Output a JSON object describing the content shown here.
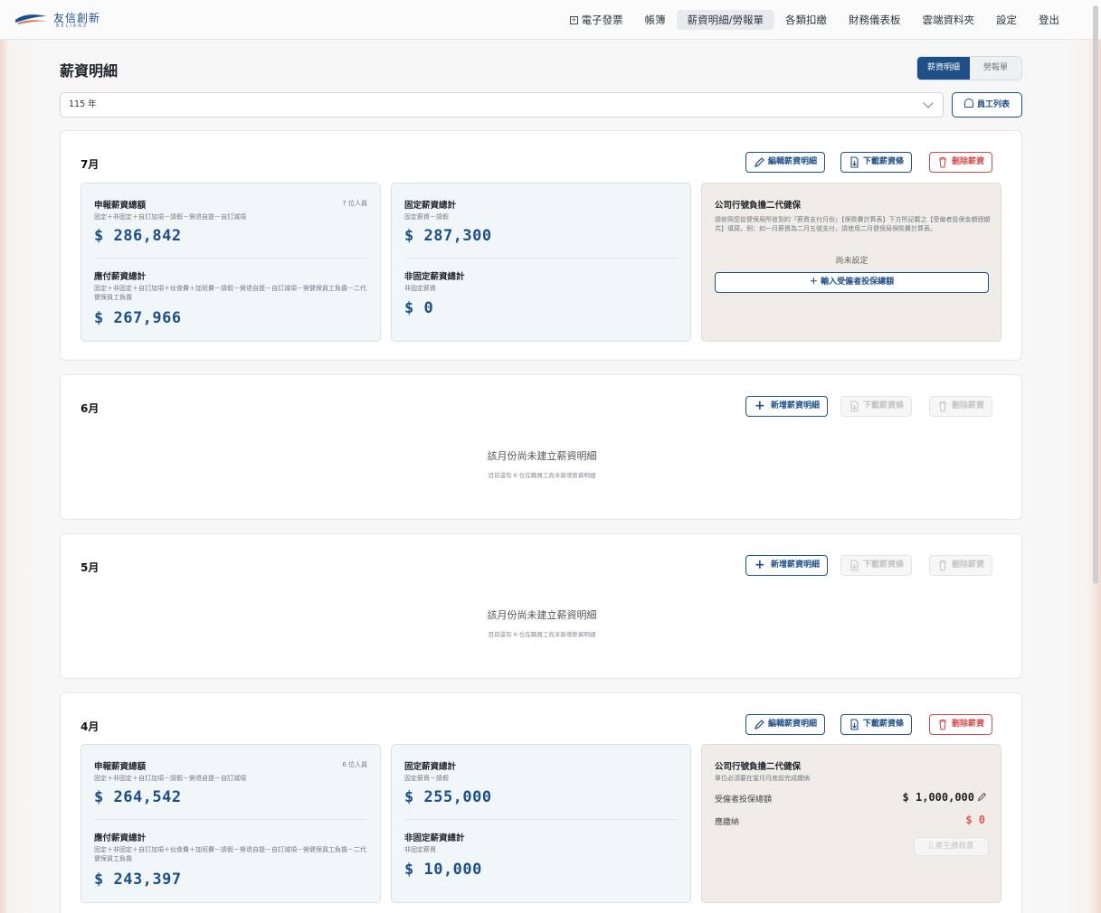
{
  "brand": {
    "name": "友信創新",
    "sub": "BELIANZ",
    "colors": {
      "primary": "#1e4f86",
      "danger": "#d34b4b"
    }
  },
  "nav": [
    "電子發票",
    "帳簿",
    "薪資明細/勞報單",
    "各類扣繳",
    "財務儀表板",
    "雲端資料夾",
    "設定",
    "登出"
  ],
  "page": {
    "title": "薪資明細",
    "tabs": [
      "薪資明細",
      "勞報單"
    ],
    "year": "115 年",
    "employee_list": "員工列表"
  },
  "buttons": {
    "edit": "編輯薪資明細",
    "download": "下載薪資條",
    "delete": "刪除薪資",
    "add": "新增薪資明細",
    "input_nhi": "輸入受僱者投保總額",
    "generate_bill": "產生繳款書"
  },
  "labels": {
    "declared_total": "申報薪資總額",
    "declared_formula": "固定＋非固定＋自訂加項－請假－勞退自提－自訂減項",
    "payable_total": "應付薪資總計",
    "payable_formula": "固定＋非固定＋自訂加項＋伙食費＋加班費－請假－勞退自提－自訂減項－勞健保員工負擔－二代健保員工負擔",
    "fixed_total": "固定薪資總計",
    "fixed_formula": "固定薪資－請假",
    "nonfixed_total": "非固定薪資總計",
    "nonfixed_formula": "非固定薪資",
    "company_nhi": "公司行號負擔二代健保"
  },
  "months": {
    "july": {
      "title": "7月",
      "people": "7 位人員",
      "declared": "$ 286,842",
      "payable": "$ 267,966",
      "fixed": "$ 287,300",
      "nonfixed": "$ 0",
      "nhi_note": "請依照您從健保局所收到的『薪資支付月份』【保險費計算表】下方所記載之【受僱者投保金額總額共】填寫。例：如一月薪資為二月五號支付，請使用二月健保局保險費計算表。",
      "not_set": "尚未設定"
    },
    "june": {
      "title": "6月",
      "empty_main": "該月份尚未建立薪資明細",
      "empty_sub": "目前還有 6 位在職員工尚未新增薪資明細"
    },
    "may": {
      "title": "5月",
      "empty_main": "該月份尚未建立薪資明細",
      "empty_sub": "目前還有 6 位在職員工尚未新增薪資明細"
    },
    "april": {
      "title": "4月",
      "people": "6 位人員",
      "declared": "$ 264,542",
      "payable": "$ 243,397",
      "fixed": "$ 255,000",
      "nonfixed": "$ 10,000",
      "nhi_note": "單位必須要在當月月底前完成繳納",
      "insured_label": "受僱者投保總額",
      "insured_value": "$ 1,000,000",
      "due_label": "應繳納",
      "due_value": "$ 0"
    }
  }
}
